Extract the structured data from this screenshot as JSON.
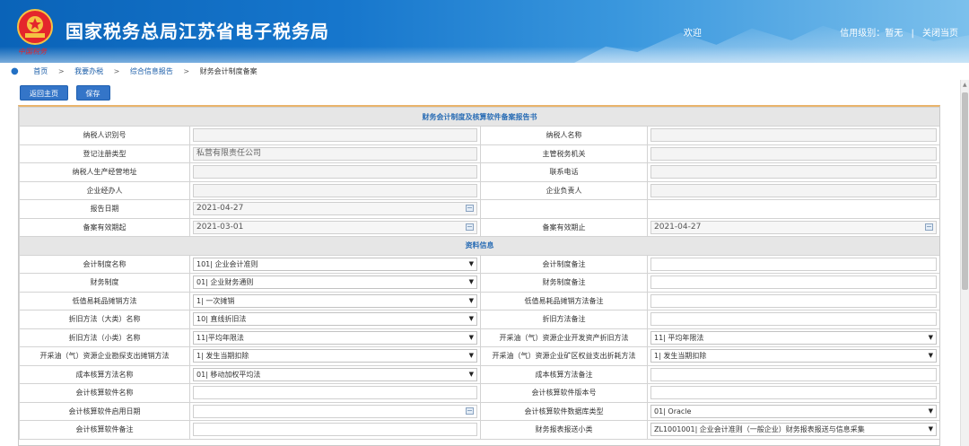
{
  "header": {
    "site_title": "国家税务总局江苏省电子税务局",
    "emblem_caption": "中国税务",
    "welcome": "欢迎",
    "credit_label": "信用级别：暂无",
    "logout": "关闭当页",
    "colors": {
      "header_blue": "#0a63b8",
      "emblem_red": "#e4262c"
    }
  },
  "breadcrumb": {
    "items": [
      "首页",
      "我要办税",
      "综合信息报告",
      "财务会计制度备案"
    ],
    "separator": ">"
  },
  "toolbar": {
    "back_label": "返回主页",
    "save_label": "保存"
  },
  "form": {
    "title": "财务会计制度及核算软件备案报告书",
    "basic": {
      "taxpayer_id": {
        "label": "纳税人识别号",
        "value": ""
      },
      "taxpayer_name": {
        "label": "纳税人名称",
        "value": ""
      },
      "reg_type": {
        "label": "登记注册类型",
        "value": "私营有限责任公司"
      },
      "tax_authority": {
        "label": "主管税务机关",
        "value": ""
      },
      "address": {
        "label": "纳税人生产经营地址",
        "value": ""
      },
      "phone": {
        "label": "联系电话",
        "value": ""
      },
      "handler": {
        "label": "企业经办人",
        "value": ""
      },
      "person_in_charge": {
        "label": "企业负责人",
        "value": ""
      },
      "report_date": {
        "label": "报告日期",
        "value": "2021-04-27"
      },
      "valid_from": {
        "label": "备案有效期起",
        "value": "2021-03-01"
      },
      "valid_to": {
        "label": "备案有效期止",
        "value": "2021-04-27"
      }
    },
    "section_title": "资料信息",
    "info": {
      "acct_system_name": {
        "label": "会计制度名称",
        "value": "101| 企业会计准则"
      },
      "acct_system_note": {
        "label": "会计制度备注",
        "value": ""
      },
      "fin_system": {
        "label": "财务制度",
        "value": "01| 企业财务通则"
      },
      "fin_system_note": {
        "label": "财务制度备注",
        "value": ""
      },
      "low_value_method": {
        "label": "低值易耗品摊销方法",
        "value": "1| 一次摊销"
      },
      "low_value_note": {
        "label": "低值易耗品摊销方法备注",
        "value": ""
      },
      "depr_major": {
        "label": "折旧方法（大类）名称",
        "value": "10| 直线折旧法"
      },
      "depr_note": {
        "label": "折旧方法备注",
        "value": ""
      },
      "depr_minor": {
        "label": "折旧方法（小类）名称",
        "value": "11|平均年限法"
      },
      "oil_gas_depr": {
        "label": "开采油（气）资源企业开发资产折旧方法",
        "value": "11| 平均年限法"
      },
      "oil_gas_explore": {
        "label": "开采油（气）资源企业勘探支出摊销方法",
        "value": "1| 发生当期扣除"
      },
      "oil_gas_mine": {
        "label": "开采油（气）资源企业矿区权益支出折耗方法",
        "value": "1| 发生当期扣除"
      },
      "cost_method": {
        "label": "成本核算方法名称",
        "value": "01| 移动加权平均法"
      },
      "cost_note": {
        "label": "成本核算方法备注",
        "value": ""
      },
      "software_name": {
        "label": "会计核算软件名称",
        "value": ""
      },
      "software_version": {
        "label": "会计核算软件版本号",
        "value": ""
      },
      "software_start": {
        "label": "会计核算软件启用日期",
        "value": ""
      },
      "software_db": {
        "label": "会计核算软件数据库类型",
        "value": "01| Oracle"
      },
      "software_note": {
        "label": "会计核算软件备注",
        "value": ""
      },
      "report_subcat": {
        "label": "财务报表报送小类",
        "value": "ZL1001001| 企业会计准则（一般企业）财务报表报送与信息采集"
      }
    }
  }
}
